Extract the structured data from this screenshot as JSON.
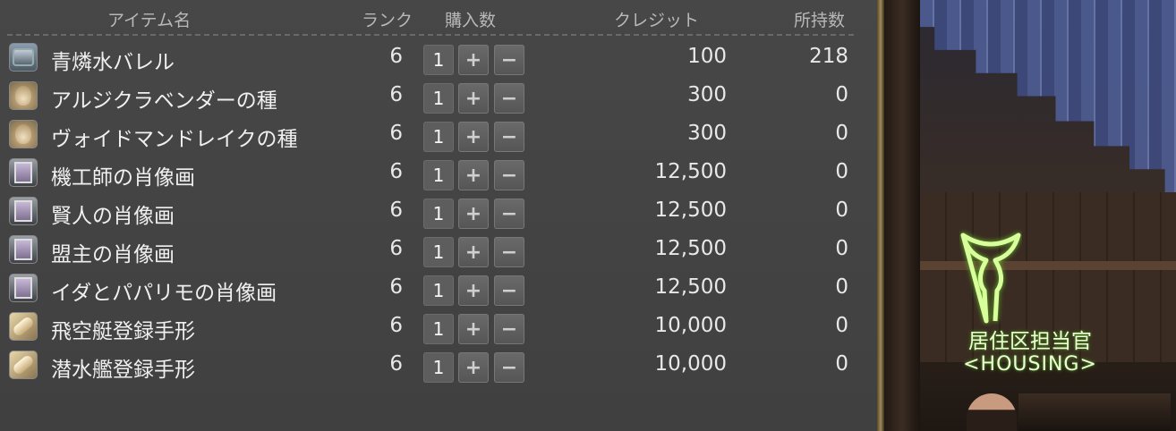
{
  "header": {
    "name": "アイテム名",
    "rank": "ランク",
    "quantity": "購入数",
    "credit": "クレジット",
    "owned": "所持数"
  },
  "buttons": {
    "plus": "+",
    "minus": "−"
  },
  "items": [
    {
      "name": "青燐水バレル",
      "icon": "ceruleum-barrel-icon",
      "rank": "6",
      "qty": "1",
      "credit": "100",
      "owned": "218"
    },
    {
      "name": "アルジクラベンダーの種",
      "icon": "seed-bag-icon",
      "rank": "6",
      "qty": "1",
      "credit": "300",
      "owned": "0"
    },
    {
      "name": "ヴォイドマンドレイクの種",
      "icon": "seed-bag-icon",
      "rank": "6",
      "qty": "1",
      "credit": "300",
      "owned": "0"
    },
    {
      "name": "機工師の肖像画",
      "icon": "portrait-icon",
      "rank": "6",
      "qty": "1",
      "credit": "12,500",
      "owned": "0"
    },
    {
      "name": "賢人の肖像画",
      "icon": "portrait-icon",
      "rank": "6",
      "qty": "1",
      "credit": "12,500",
      "owned": "0"
    },
    {
      "name": "盟主の肖像画",
      "icon": "portrait-icon",
      "rank": "6",
      "qty": "1",
      "credit": "12,500",
      "owned": "0"
    },
    {
      "name": "イダとパパリモの肖像画",
      "icon": "portrait-icon",
      "rank": "6",
      "qty": "1",
      "credit": "12,500",
      "owned": "0"
    },
    {
      "name": "飛空艇登録手形",
      "icon": "scroll-icon",
      "rank": "6",
      "qty": "1",
      "credit": "10,000",
      "owned": "0"
    },
    {
      "name": "潜水艦登録手形",
      "icon": "scroll-icon",
      "rank": "6",
      "qty": "1",
      "credit": "10,000",
      "owned": "0"
    }
  ],
  "npc": {
    "title": "居住区担当官",
    "subtitle": "<HOUSING>"
  },
  "colors": {
    "panel_bg": "#444444",
    "text": "#e8e8e8",
    "header_text": "#b8b8b8",
    "npc_label": "#eaffd6",
    "npc_glow": "#4e8a1e"
  }
}
